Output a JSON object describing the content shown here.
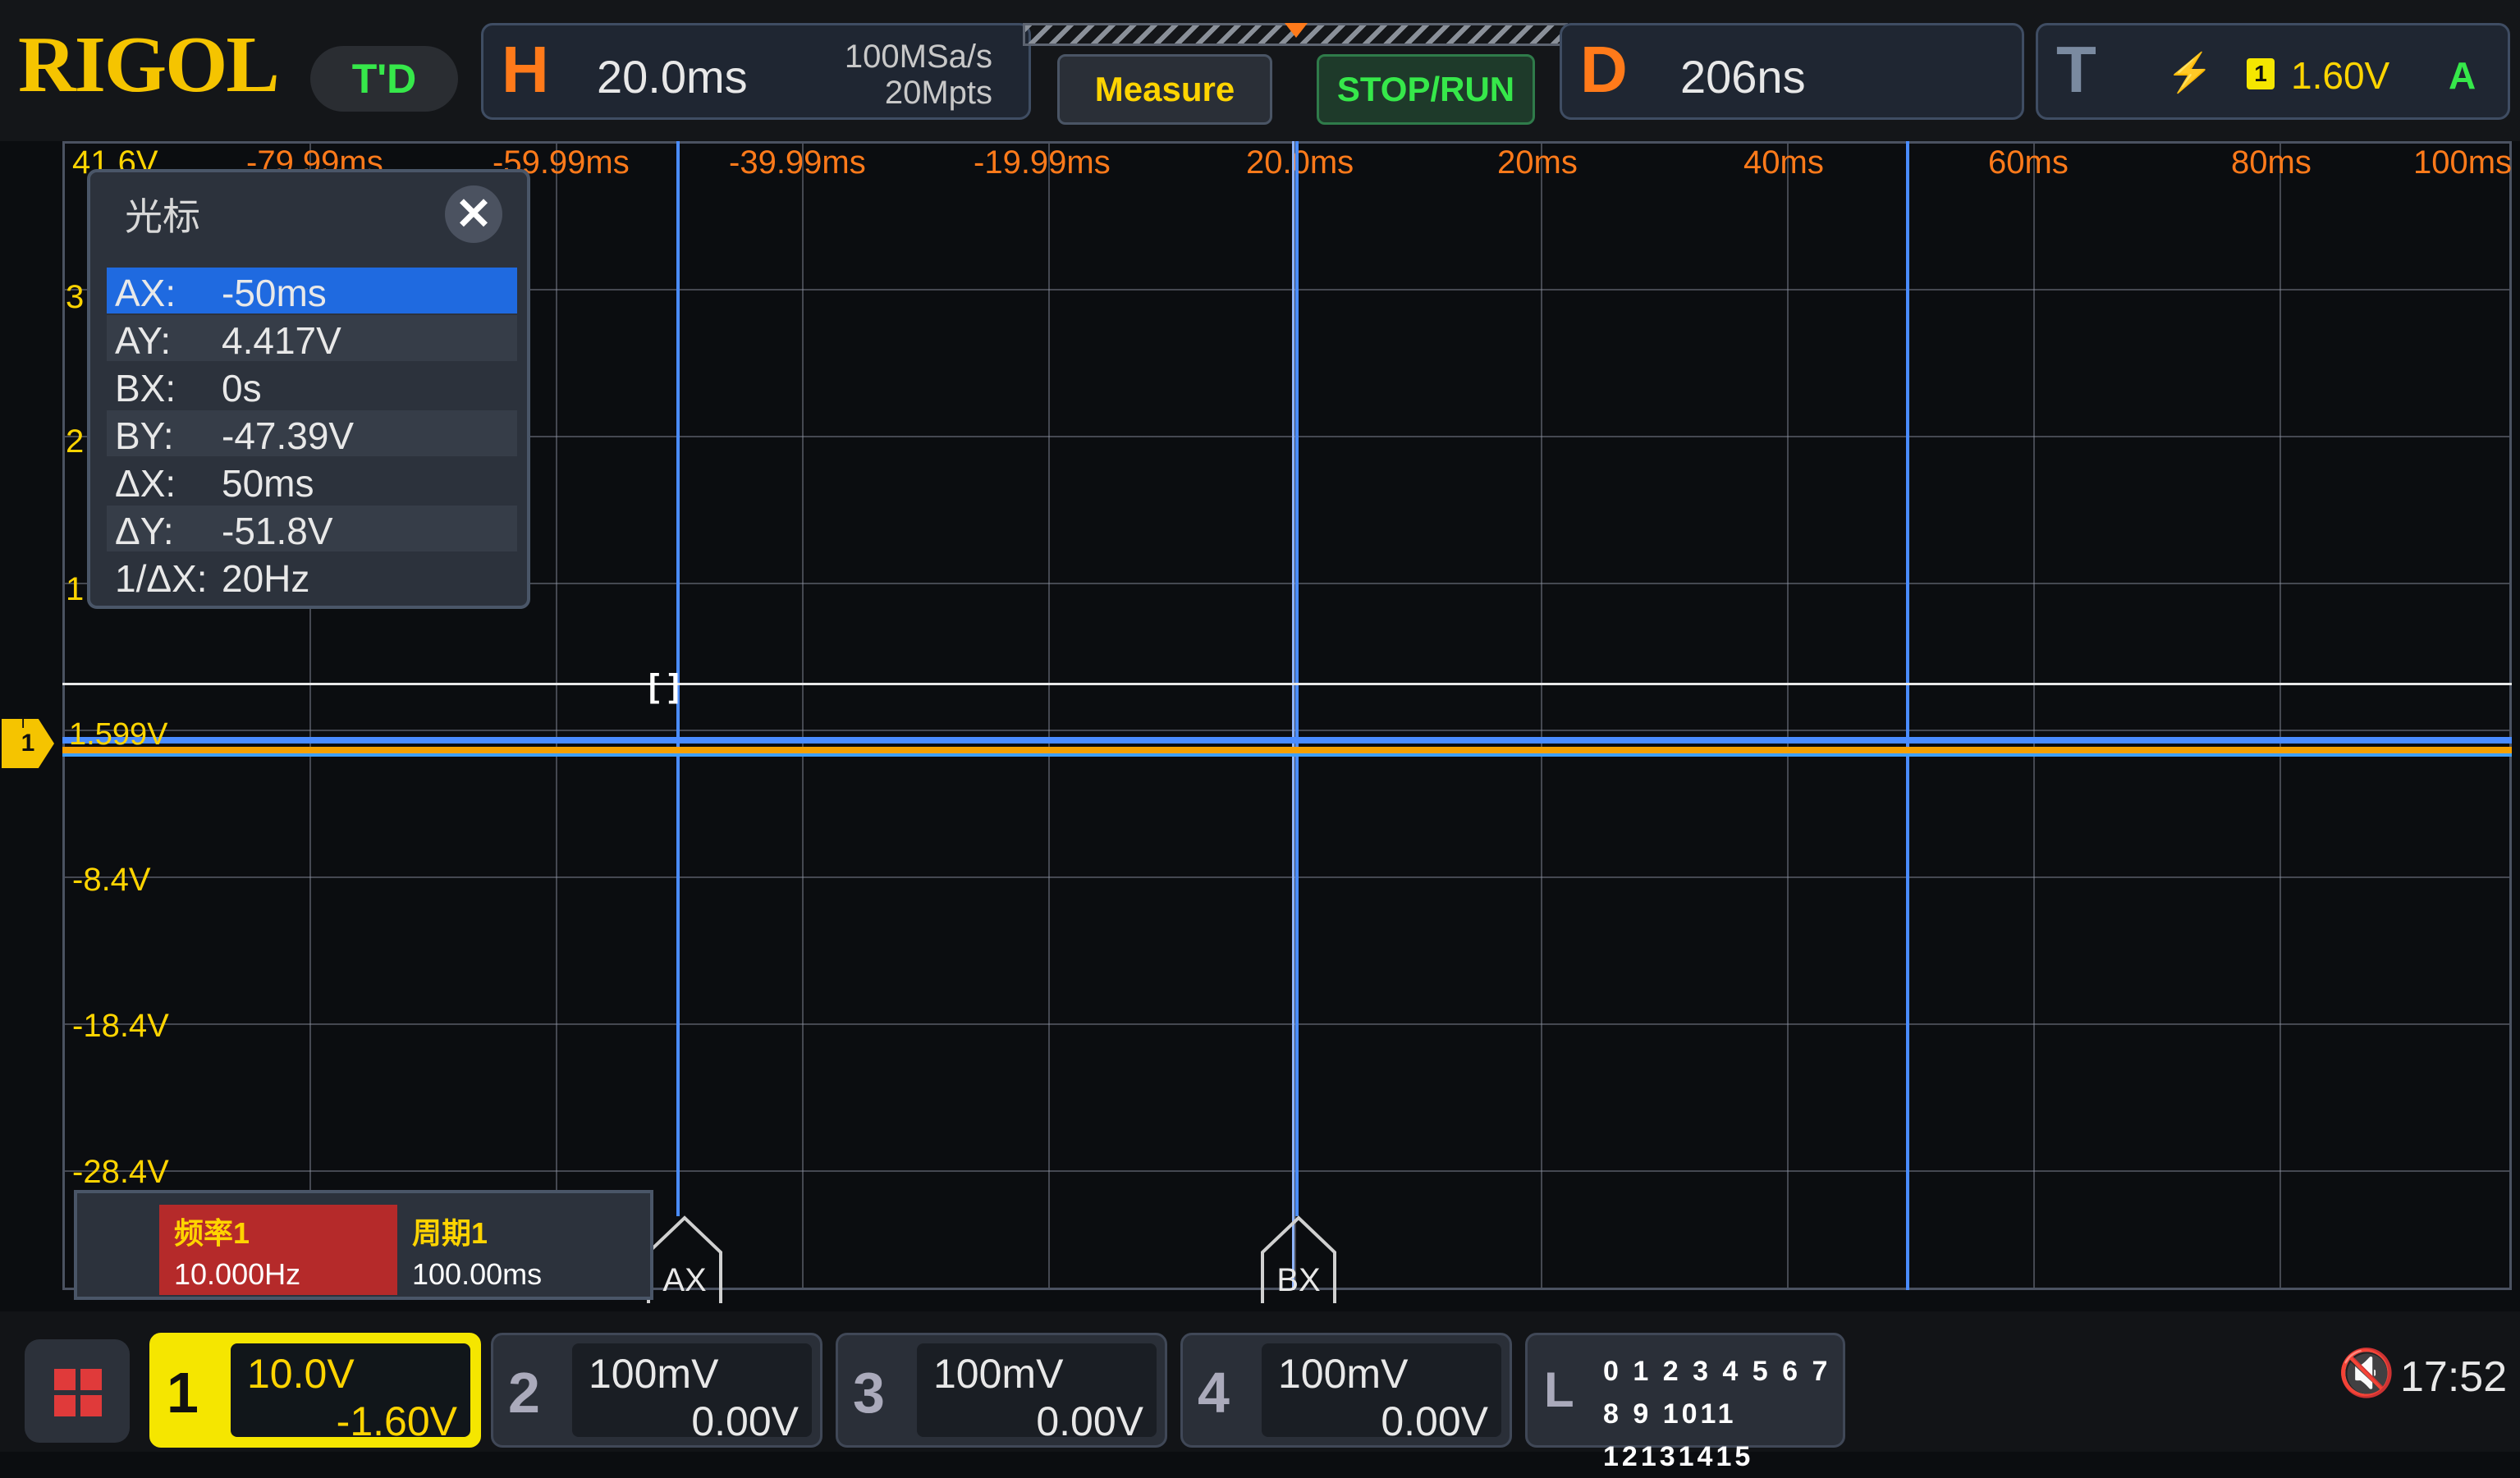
{
  "brand": "RIGOL",
  "mode": "T'D",
  "horizontal": {
    "letter": "H",
    "timebase": "20.0ms",
    "sample_rate": "100MSa/s",
    "memory_depth": "20Mpts"
  },
  "buttons": {
    "measure": "Measure",
    "stop_run": "STOP/RUN"
  },
  "delay": {
    "letter": "D",
    "value": "206ns"
  },
  "trigger": {
    "letter": "T",
    "slope_icon": "rising-edge-icon",
    "source": "1",
    "level": "1.60V",
    "mode": "A"
  },
  "time_axis": [
    "-79.99ms",
    "-59.99ms",
    "-39.99ms",
    "-19.99ms",
    "20.0ms",
    "20ms",
    "40ms",
    "60ms",
    "80ms",
    "100ms"
  ],
  "volt_axis": [
    "41.6V",
    "3",
    "2",
    "1",
    "-8.4V",
    "-18.4V",
    "-28.4V"
  ],
  "channel1_level": "1.599V",
  "trigger_marker_text": "T",
  "cursor_dialog": {
    "title": "光标",
    "close": "✕",
    "rows": [
      {
        "k": "AX:",
        "v": "-50ms"
      },
      {
        "k": "AY:",
        "v": "4.417V"
      },
      {
        "k": "BX:",
        "v": "0s"
      },
      {
        "k": "BY:",
        "v": "-47.39V"
      },
      {
        "k": "ΔX:",
        "v": "50ms"
      },
      {
        "k": "ΔY:",
        "v": "-51.8V"
      },
      {
        "k": "1/ΔX:",
        "v": "20Hz"
      }
    ]
  },
  "cursor_tags": {
    "a": "AX",
    "b": "BX"
  },
  "measurements": [
    {
      "name": "频率1",
      "value": "10.000Hz",
      "color": "#b52a2a"
    },
    {
      "name": "周期1",
      "value": "100.00ms",
      "color": "#2c323c"
    }
  ],
  "channels": [
    {
      "num": "1",
      "scale": "10.0V",
      "offset": "-1.60V"
    },
    {
      "num": "2",
      "scale": "100mV",
      "offset": "0.00V"
    },
    {
      "num": "3",
      "scale": "100mV",
      "offset": "0.00V"
    },
    {
      "num": "4",
      "scale": "100mV",
      "offset": "0.00V"
    }
  ],
  "logic": {
    "label": "L",
    "row1": "0 1 2 3  4 5 6 7",
    "row2": "8 9 1011 12131415"
  },
  "status": {
    "mute_icon": "speaker-mute-icon",
    "clock": "17:52"
  },
  "colors": {
    "ch1": "#f5e600",
    "cursor": "#4a8cff",
    "accent": "#ff7a1a"
  }
}
